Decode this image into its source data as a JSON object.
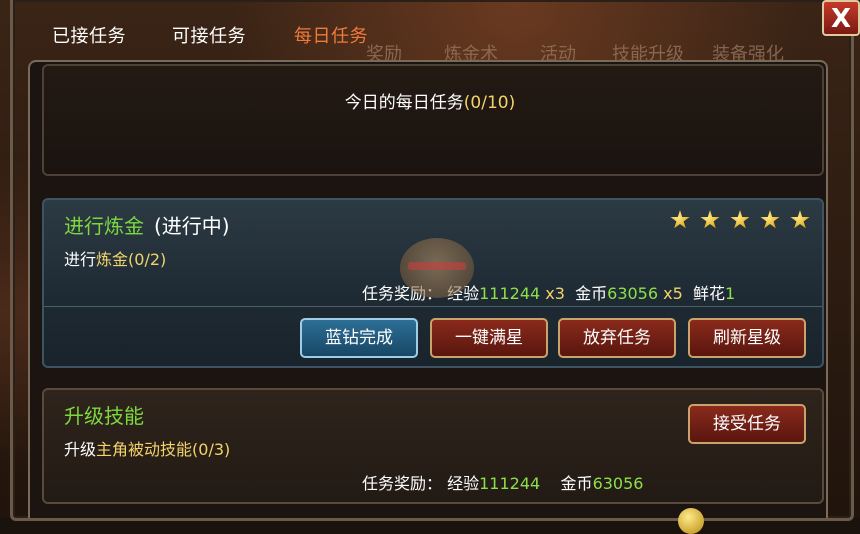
{
  "tabs": [
    {
      "label": "已接任务"
    },
    {
      "label": "可接任务"
    },
    {
      "label": "每日任务"
    }
  ],
  "close": {
    "label": "X"
  },
  "background_labels": [
    "奖励",
    "炼金术",
    "活动",
    "技能升级",
    "装备强化"
  ],
  "header": {
    "title": "今日的每日任务",
    "progress": "(0/10)"
  },
  "tasks": [
    {
      "name": "进行炼金",
      "status": "(进行中)",
      "desc_prefix": "进行",
      "desc_highlight": "炼金(0/2)",
      "stars": 5,
      "reward_label": "任务奖励：",
      "exp_label": "经验",
      "exp_value": "111244",
      "exp_mult": "x3",
      "gold_label": "金币",
      "gold_value": "63056",
      "gold_mult": "x5",
      "flower_label": "鲜花",
      "flower_value": "1",
      "buttons": [
        {
          "label": "蓝钻完成"
        },
        {
          "label": "一键满星"
        },
        {
          "label": "放弃任务"
        },
        {
          "label": "刷新星级"
        }
      ]
    },
    {
      "name": "升级技能",
      "desc_prefix": "升级",
      "desc_highlight": "主角被动技能(0/3)",
      "reward_label": "任务奖励：",
      "exp_label": "经验",
      "exp_value": "111244",
      "gold_label": "金币",
      "gold_value": "63056",
      "buttons": [
        {
          "label": "接受任务"
        }
      ]
    }
  ],
  "colors": {
    "active_tab": "#f07a3a",
    "task_name": "#7dd83e",
    "highlight": "#f2d36a",
    "reward_number": "#8ee04a"
  }
}
